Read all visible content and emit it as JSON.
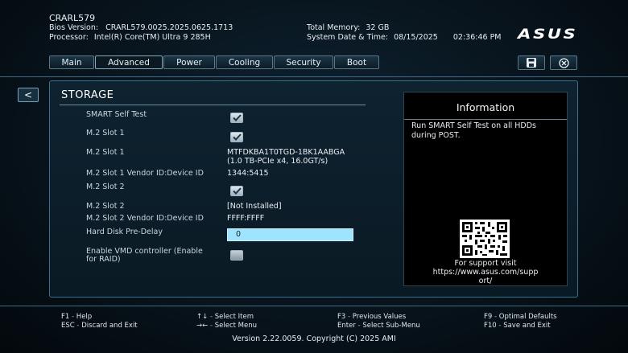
{
  "header": {
    "machine": "CRARL579",
    "bios_label": "Bios Version:",
    "bios_value": "CRARL579.0025.2025.0625.1713",
    "processor_label": "Processor:",
    "processor_value": "Intel(R) Core(TM) Ultra 9 285H",
    "memory_label": "Total Memory:",
    "memory_value": "32 GB",
    "datetime_label": "System Date & Time:",
    "date_value": "08/15/2025",
    "time_value": "02:36:46 PM",
    "logo": "ASUS"
  },
  "tabs": [
    {
      "label": "Main"
    },
    {
      "label": "Advanced"
    },
    {
      "label": "Power"
    },
    {
      "label": "Cooling"
    },
    {
      "label": "Security"
    },
    {
      "label": "Boot"
    }
  ],
  "toolbar": {
    "back_label": "<"
  },
  "storage": {
    "title": "STORAGE",
    "rows": [
      {
        "label": "SMART Self Test",
        "checked": true
      },
      {
        "label": "M.2 Slot 1",
        "checked": true
      },
      {
        "label": "M.2 Slot 1",
        "value_line1": "MTFDKBA1T0TGD-1BK1AABGA",
        "value_line2": "(1.0 TB-PCIe x4, 16.0GT/s)"
      },
      {
        "label": "M.2 Slot 1 Vendor ID:Device ID",
        "value": "1344:5415"
      },
      {
        "label": "M.2 Slot 2",
        "checked": true
      },
      {
        "label": "M.2 Slot 2",
        "value": "[Not Installed]"
      },
      {
        "label": "M.2 Slot 2 Vendor ID:Device ID",
        "value": "FFFF:FFFF"
      },
      {
        "label": "Hard Disk Pre-Delay",
        "value": "0"
      },
      {
        "label_line1": "Enable VMD controller (Enable",
        "label_line2": "for RAID)",
        "checked": false
      }
    ]
  },
  "info": {
    "title": "Information",
    "text": "Run SMART Self Test on all HDDs during POST.",
    "support_line1": "For support visit",
    "support_line2": "https://www.asus.com/supp",
    "support_line3": "ort/"
  },
  "footer": {
    "f1_key": "F1",
    "f1_desc": "Help",
    "esc_key": "ESC",
    "esc_desc": "Discard and Exit",
    "arrows_ud_key": "↑↓",
    "arrows_ud_desc": "Select Item",
    "arrows_lr_key": "→←",
    "arrows_lr_desc": "Select Menu",
    "f3_key": "F3",
    "f3_desc": "Previous Values",
    "enter_key": "Enter",
    "enter_desc": "Select Sub-Menu",
    "f9_key": "F9",
    "f9_desc": "Optimal Defaults",
    "f10_key": "F10",
    "f10_desc": "Save and Exit",
    "sep": " - ",
    "version": "Version 2.22.0059. Copyright (C) 2025 AMI"
  },
  "icons": {
    "save": "save-icon",
    "exit": "close-circle-icon",
    "checkbox": "checkmark-icon",
    "qr": "qr-code-icon"
  }
}
